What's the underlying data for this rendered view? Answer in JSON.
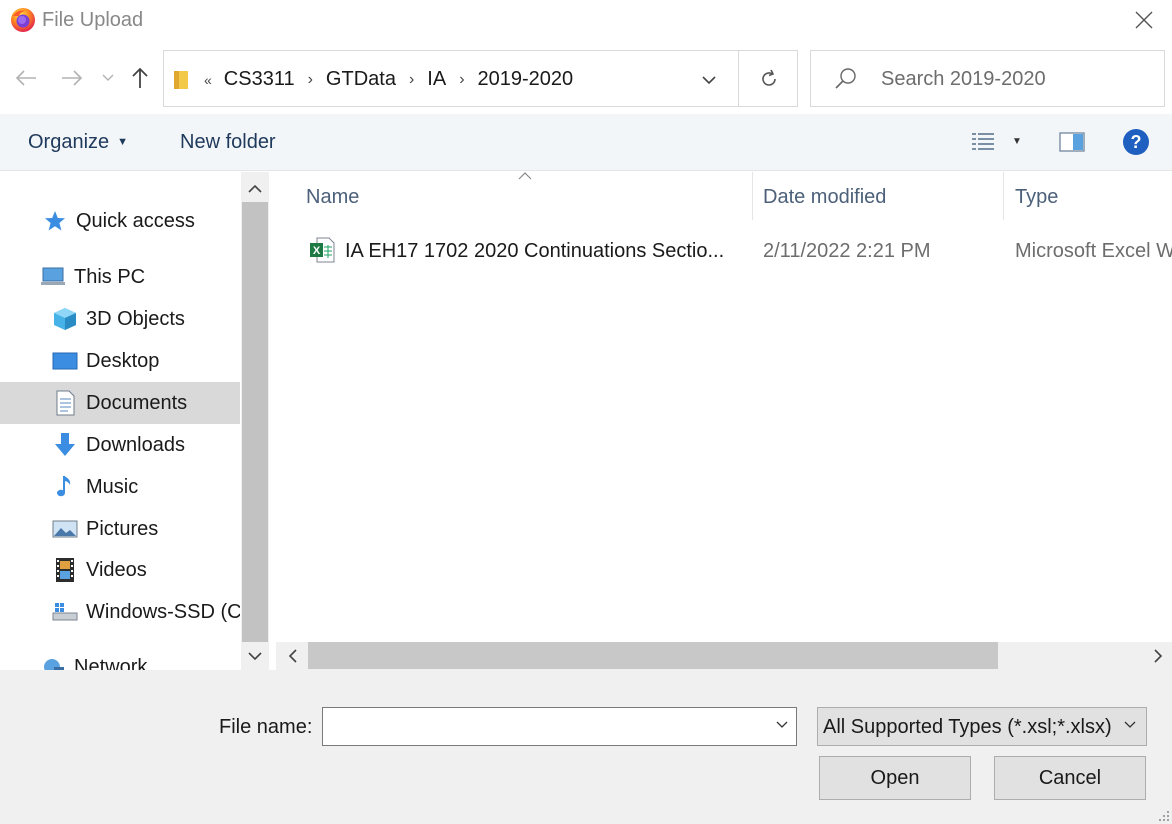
{
  "window": {
    "title": "File Upload",
    "app_icon": "firefox-icon"
  },
  "address": {
    "overflow_indicator": "«",
    "breadcrumbs": [
      "CS3311",
      "GTData",
      "IA",
      "2019-2020"
    ]
  },
  "search": {
    "placeholder": "Search 2019-2020"
  },
  "toolbar": {
    "organize_label": "Organize",
    "new_folder_label": "New folder"
  },
  "nav": {
    "items": [
      {
        "label": "Quick access",
        "icon": "star-icon"
      },
      {
        "label": "This PC",
        "icon": "computer-icon"
      },
      {
        "label": "3D Objects",
        "icon": "cube-icon"
      },
      {
        "label": "Desktop",
        "icon": "desktop-icon"
      },
      {
        "label": "Documents",
        "icon": "documents-icon",
        "selected": true
      },
      {
        "label": "Downloads",
        "icon": "download-arrow-icon"
      },
      {
        "label": "Music",
        "icon": "music-note-icon"
      },
      {
        "label": "Pictures",
        "icon": "pictures-icon"
      },
      {
        "label": "Videos",
        "icon": "film-icon"
      },
      {
        "label": "Windows-SSD (C",
        "icon": "drive-icon"
      },
      {
        "label": "Network",
        "icon": "network-icon"
      }
    ]
  },
  "columns": {
    "name": "Name",
    "date": "Date modified",
    "type": "Type"
  },
  "files": [
    {
      "name": "IA EH17 1702 2020 Continuations Sectio...",
      "date": "2/11/2022 2:21 PM",
      "type": "Microsoft Excel W",
      "icon": "excel-file-icon"
    }
  ],
  "footer": {
    "file_name_label": "File name:",
    "file_name_value": "",
    "file_type_selected": "All Supported Types (*.xsl;*.xlsx)",
    "open_label": "Open",
    "cancel_label": "Cancel"
  },
  "colors": {
    "toolbar_bg": "#f3f6f9",
    "selected_bg": "#d9d9d9",
    "link_text": "#1e395b",
    "help_blue": "#1f5fbf"
  }
}
